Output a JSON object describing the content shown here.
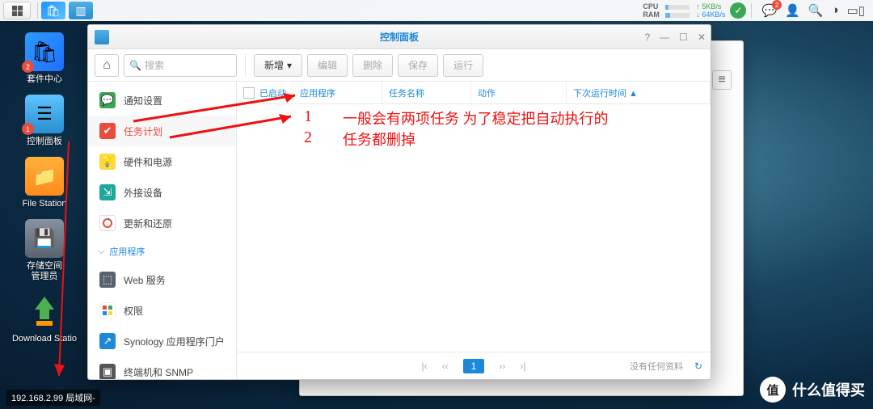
{
  "taskbar": {
    "cpu_label": "CPU",
    "ram_label": "RAM",
    "net_up": "5KB/s",
    "net_down": "64KB/s",
    "notify_count": "2"
  },
  "desktop": {
    "pkg_center": "套件中心",
    "pkg_badge": "2",
    "ctrl_panel": "控制面板",
    "ctrl_badge": "1",
    "file_station": "File Station",
    "storage": "存储空间\n管理员",
    "download": "Download Statio"
  },
  "window": {
    "title": "控制面板",
    "search_placeholder": "搜索",
    "buttons": {
      "new": "新增",
      "edit": "编辑",
      "delete": "删除",
      "save": "保存",
      "run": "运行"
    },
    "sidebar": {
      "notify": "通知设置",
      "task": "任务计划",
      "hardware": "硬件和电源",
      "external": "外接设备",
      "restore": "更新和还原",
      "group_apps": "应用程序",
      "web": "Web 服务",
      "privilege": "权限",
      "portal": "Synology 应用程序门户",
      "terminal": "终端机和 SNMP"
    },
    "columns": {
      "enabled": "已启动",
      "app": "应用程序",
      "task": "任务名称",
      "action": "动作",
      "next": "下次运行时间 ▲"
    },
    "pager": {
      "page": "1",
      "empty": "没有任何资料"
    }
  },
  "annotations": {
    "n1": "1",
    "n2": "2",
    "text": "一般会有两项任务 为了稳定把自动执行的\n任务都删掉"
  },
  "ip": {
    "text": "192.168.2.99 局域网-"
  },
  "watermark": {
    "circle": "值",
    "text": "什么值得买"
  }
}
